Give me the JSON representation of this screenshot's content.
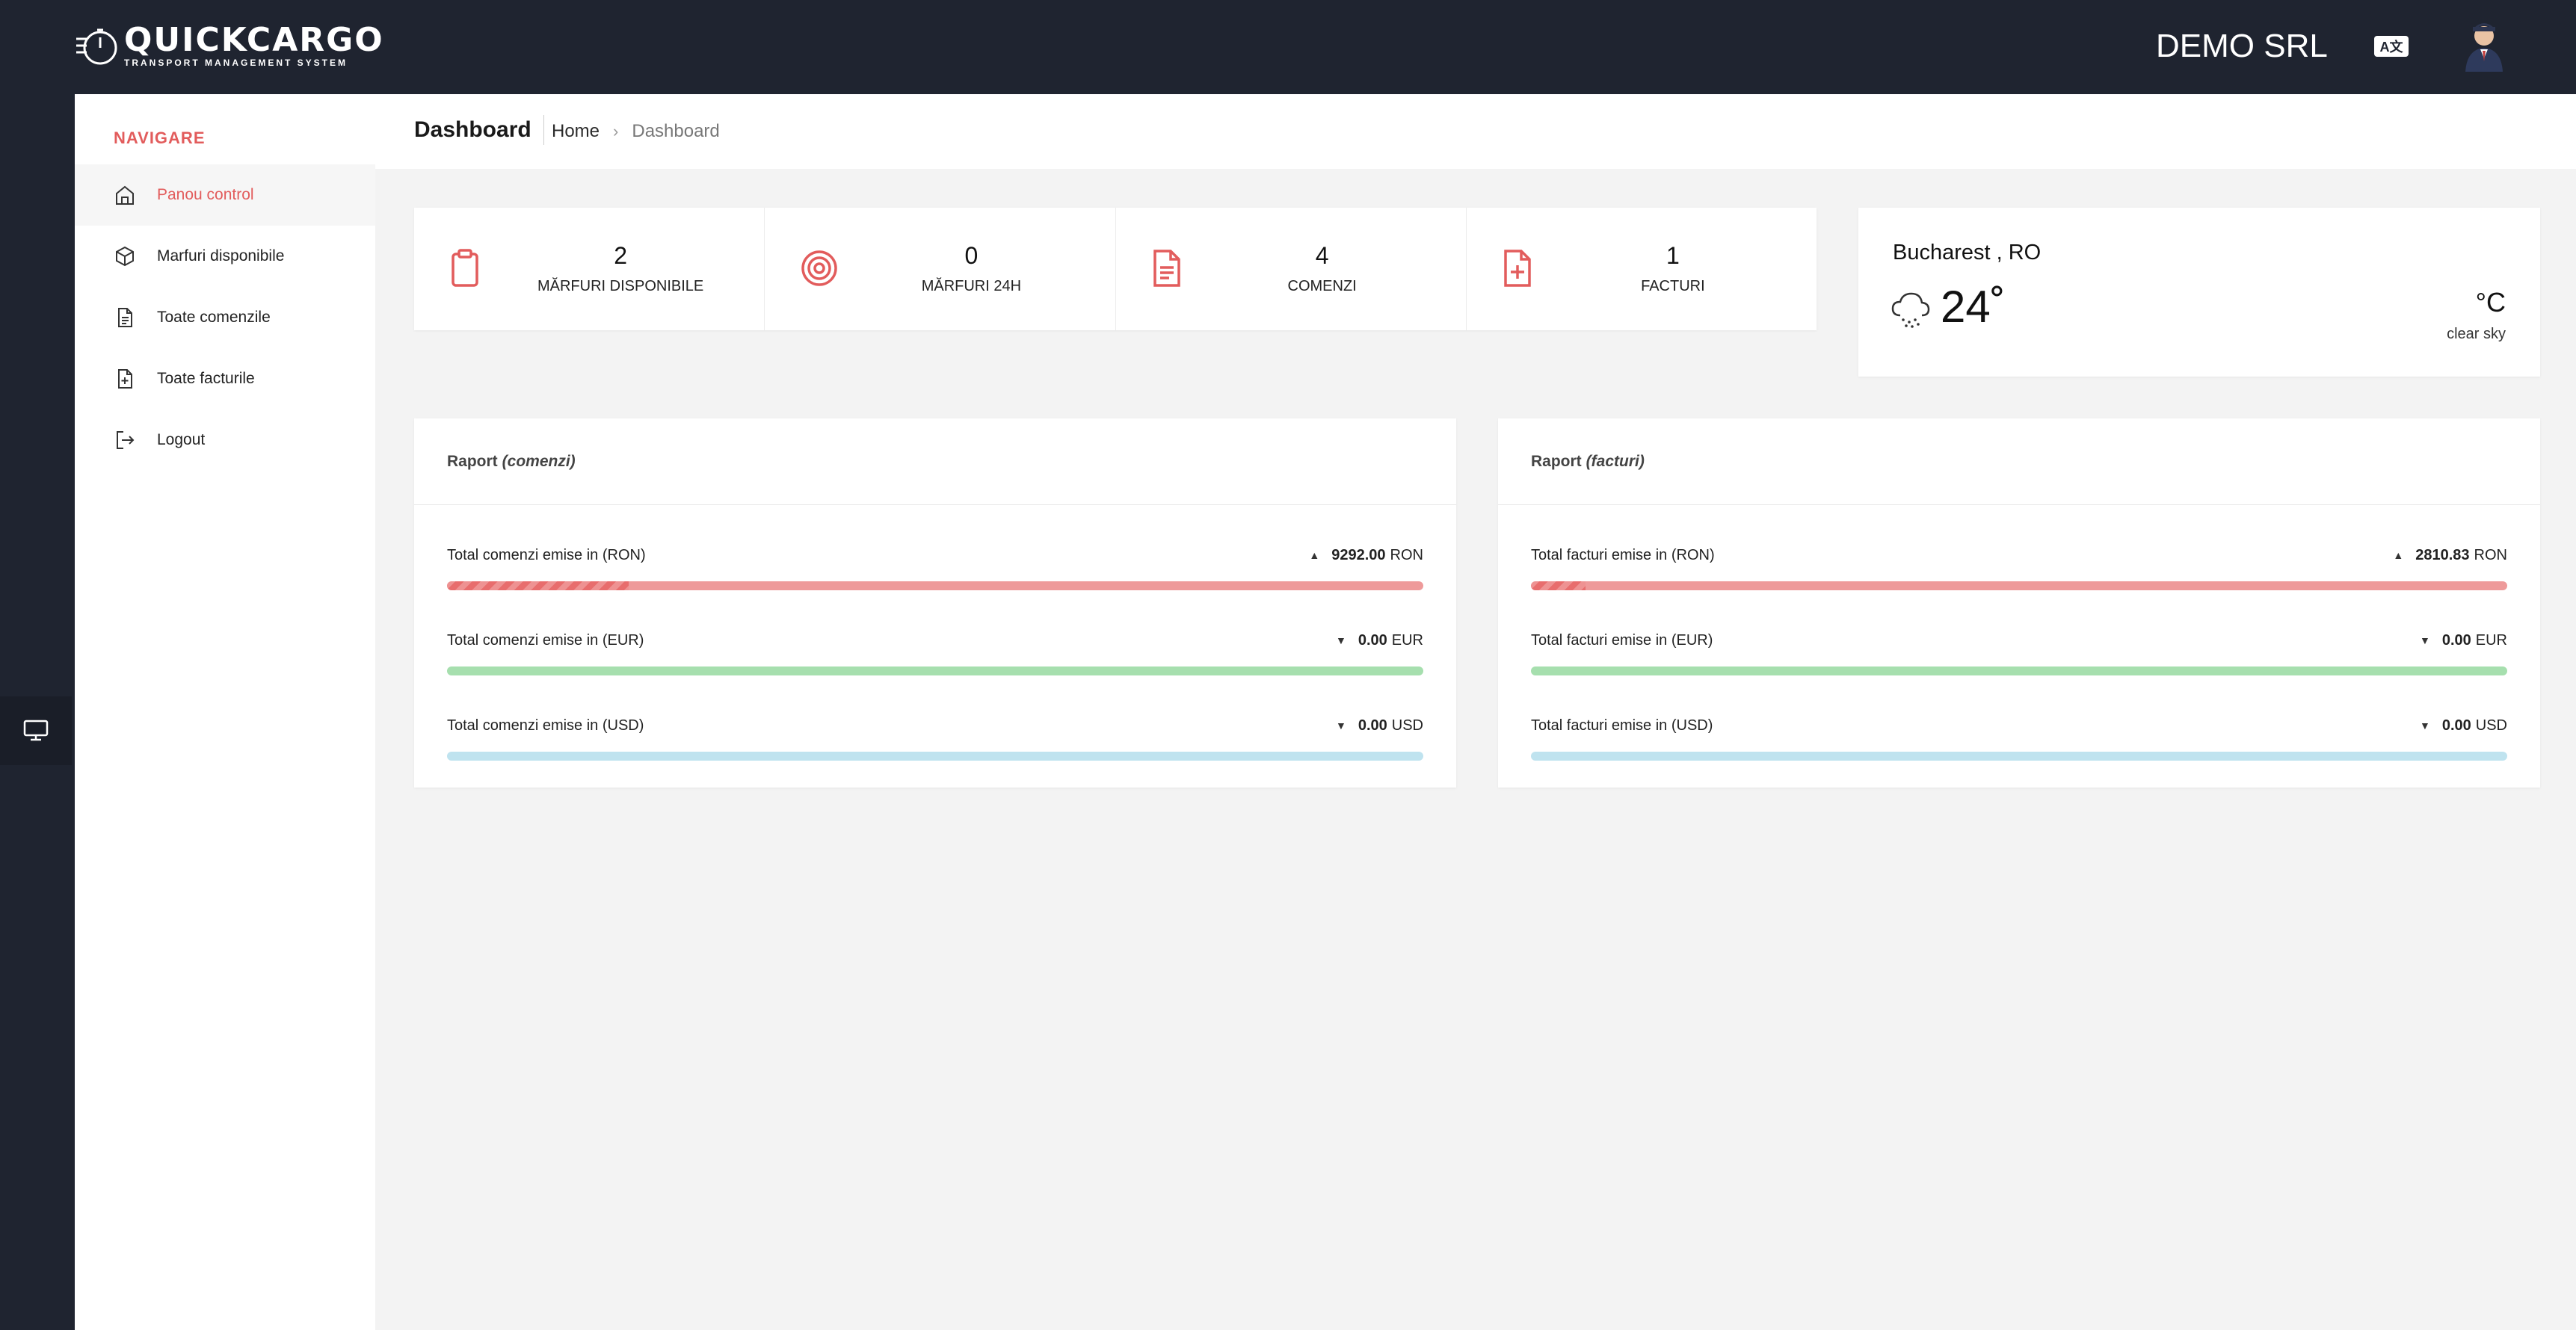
{
  "app": {
    "logo_name": "QUICKCARGO",
    "logo_subtitle": "TRANSPORT MANAGEMENT SYSTEM",
    "company": "DEMO SRL",
    "language_icon": "translate-icon",
    "avatar_icon": "user-avatar"
  },
  "sidebar": {
    "header": "NAVIGARE",
    "items": [
      {
        "label": "Panou control",
        "icon": "home-icon",
        "active": true
      },
      {
        "label": "Marfuri disponibile",
        "icon": "box-icon",
        "active": false
      },
      {
        "label": "Toate comenzile",
        "icon": "document-icon",
        "active": false
      },
      {
        "label": "Toate facturile",
        "icon": "invoice-icon",
        "active": false
      },
      {
        "label": "Logout",
        "icon": "logout-icon",
        "active": false
      }
    ]
  },
  "page": {
    "title": "Dashboard",
    "breadcrumb": {
      "home": "Home",
      "current": "Dashboard"
    }
  },
  "stats": [
    {
      "value": "2",
      "label": "MĂRFURI DISPONIBILE",
      "icon": "clipboard-icon"
    },
    {
      "value": "0",
      "label": "MĂRFURI 24H",
      "icon": "target-icon"
    },
    {
      "value": "4",
      "label": "COMENZI",
      "icon": "document-icon"
    },
    {
      "value": "1",
      "label": "FACTURI",
      "icon": "invoice-plus-icon"
    }
  ],
  "weather": {
    "city": "Bucharest , RO",
    "temperature": "24˚",
    "unit": "°C",
    "description": "clear sky",
    "icon": "cloud-drizzle-icon"
  },
  "reports": [
    {
      "title": "Raport",
      "subtitle": "(comenzi)",
      "metrics": [
        {
          "label": "Total comenzi emise in (RON)",
          "trend": "up",
          "value": "9292.00",
          "currency": "RON",
          "progress": 0.186,
          "color": "#ee9a9a",
          "fill_color": "#e86d6d"
        },
        {
          "label": "Total comenzi emise in (EUR)",
          "trend": "down",
          "value": "0.00",
          "currency": "EUR",
          "progress": 0,
          "color": "#a6dfae",
          "fill_color": "#5fbf6c"
        },
        {
          "label": "Total comenzi emise in (USD)",
          "trend": "down",
          "value": "0.00",
          "currency": "USD",
          "progress": 0,
          "color": "#bfe3ef",
          "fill_color": "#5fb4d4"
        }
      ]
    },
    {
      "title": "Raport",
      "subtitle": "(facturi)",
      "metrics": [
        {
          "label": "Total facturi emise in (RON)",
          "trend": "up",
          "value": "2810.83",
          "currency": "RON",
          "progress": 0.056,
          "color": "#ee9a9a",
          "fill_color": "#e86d6d"
        },
        {
          "label": "Total facturi emise in (EUR)",
          "trend": "down",
          "value": "0.00",
          "currency": "EUR",
          "progress": 0,
          "color": "#a6dfae",
          "fill_color": "#5fbf6c"
        },
        {
          "label": "Total facturi emise in (USD)",
          "trend": "down",
          "value": "0.00",
          "currency": "USD",
          "progress": 0,
          "color": "#bfe3ef",
          "fill_color": "#5fb4d4"
        }
      ]
    }
  ],
  "colors": {
    "accent": "#e25c5c",
    "topbar": "#1f2430"
  }
}
